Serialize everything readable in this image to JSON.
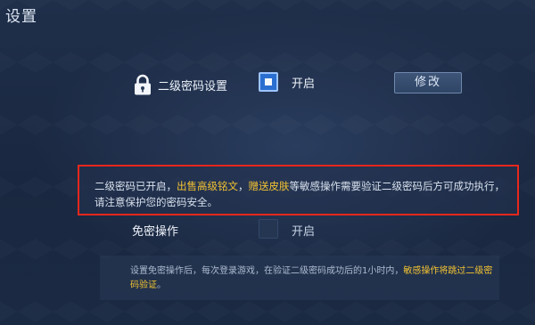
{
  "page": {
    "title": "设置"
  },
  "secondary_password": {
    "label": "二级密码设置",
    "toggle_label": "开启",
    "toggle_checked": true,
    "modify_button": "修改"
  },
  "warning": {
    "part1": "二级密码已开启，",
    "highlight1": "出售高级铭文",
    "sep": "，",
    "highlight2": "赠送皮肤",
    "part2": "等敏感操作需要验证二级密码后方可成功执行，请注意保护您的密码安全。"
  },
  "password_free": {
    "label": "免密操作",
    "toggle_label": "开启",
    "toggle_checked": false
  },
  "info": {
    "part1": "设置免密操作后，每次登录游戏，在验证二级密码成功后的1小时内，",
    "highlight": "敏感操作将跳过二级密码验证",
    "part2": "。"
  },
  "colors": {
    "highlight": "#f3c232",
    "warning_border": "#e8271c",
    "toggle_on": "#2a6fd0"
  },
  "icons": {
    "lock": "lock-icon"
  }
}
